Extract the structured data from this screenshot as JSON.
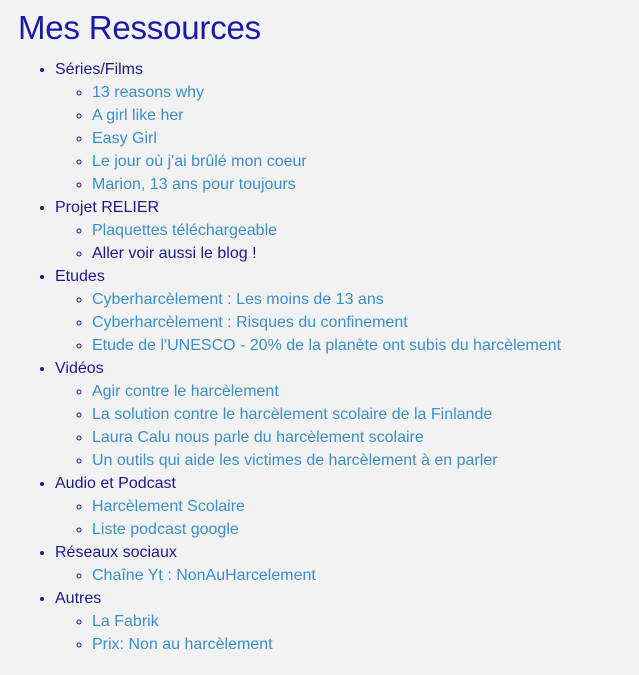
{
  "page": {
    "title": "Mes Ressources"
  },
  "sections": [
    {
      "label": "Séries/Films",
      "items": [
        {
          "text": "13 reasons why"
        },
        {
          "text": "A girl like her"
        },
        {
          "text": "Easy Girl"
        },
        {
          "text": "Le jour où j'ai brûlé mon coeur"
        },
        {
          "text": "Marion, 13 ans pour toujours"
        }
      ]
    },
    {
      "label": "Projet RELIER",
      "items": [
        {
          "text": "Plaquettes téléchargeable"
        },
        {
          "text": "Aller voir aussi le blog !",
          "style": "dark"
        }
      ]
    },
    {
      "label": "Etudes",
      "items": [
        {
          "text": "Cyberharcèlement : Les moins de 13 ans"
        },
        {
          "text": "Cyberharcèlement : Risques du confinement"
        },
        {
          "text": "Etude de l'UNESCO - 20% de la planète ont subis du harcèlement"
        }
      ]
    },
    {
      "label": "Vidéos",
      "items": [
        {
          "text": "Agir contre le harcèlement"
        },
        {
          "text": "La solution contre le harcèlement scolaire de la Finlande"
        },
        {
          "text": "Laura Calu nous parle du harcèlement scolaire"
        },
        {
          "text": "Un outils qui aide les victimes de harcèlement à en parler"
        }
      ]
    },
    {
      "label": "Audio et Podcast",
      "items": [
        {
          "text": "Harcèlement Scolaire"
        },
        {
          "text": "Liste podcast google"
        }
      ]
    },
    {
      "label": "Réseaux sociaux",
      "items": [
        {
          "text": "Chaîne Yt : NonAuHarcelement"
        }
      ]
    },
    {
      "label": "Autres",
      "items": [
        {
          "text": "La Fabrik"
        },
        {
          "text": "Prix: Non au harcèlement"
        }
      ]
    }
  ],
  "colors": {
    "background": "#f2f2f2",
    "heading": "#1a1aa6",
    "section_text": "#1a1a8c",
    "link": "#3b8fc8"
  }
}
